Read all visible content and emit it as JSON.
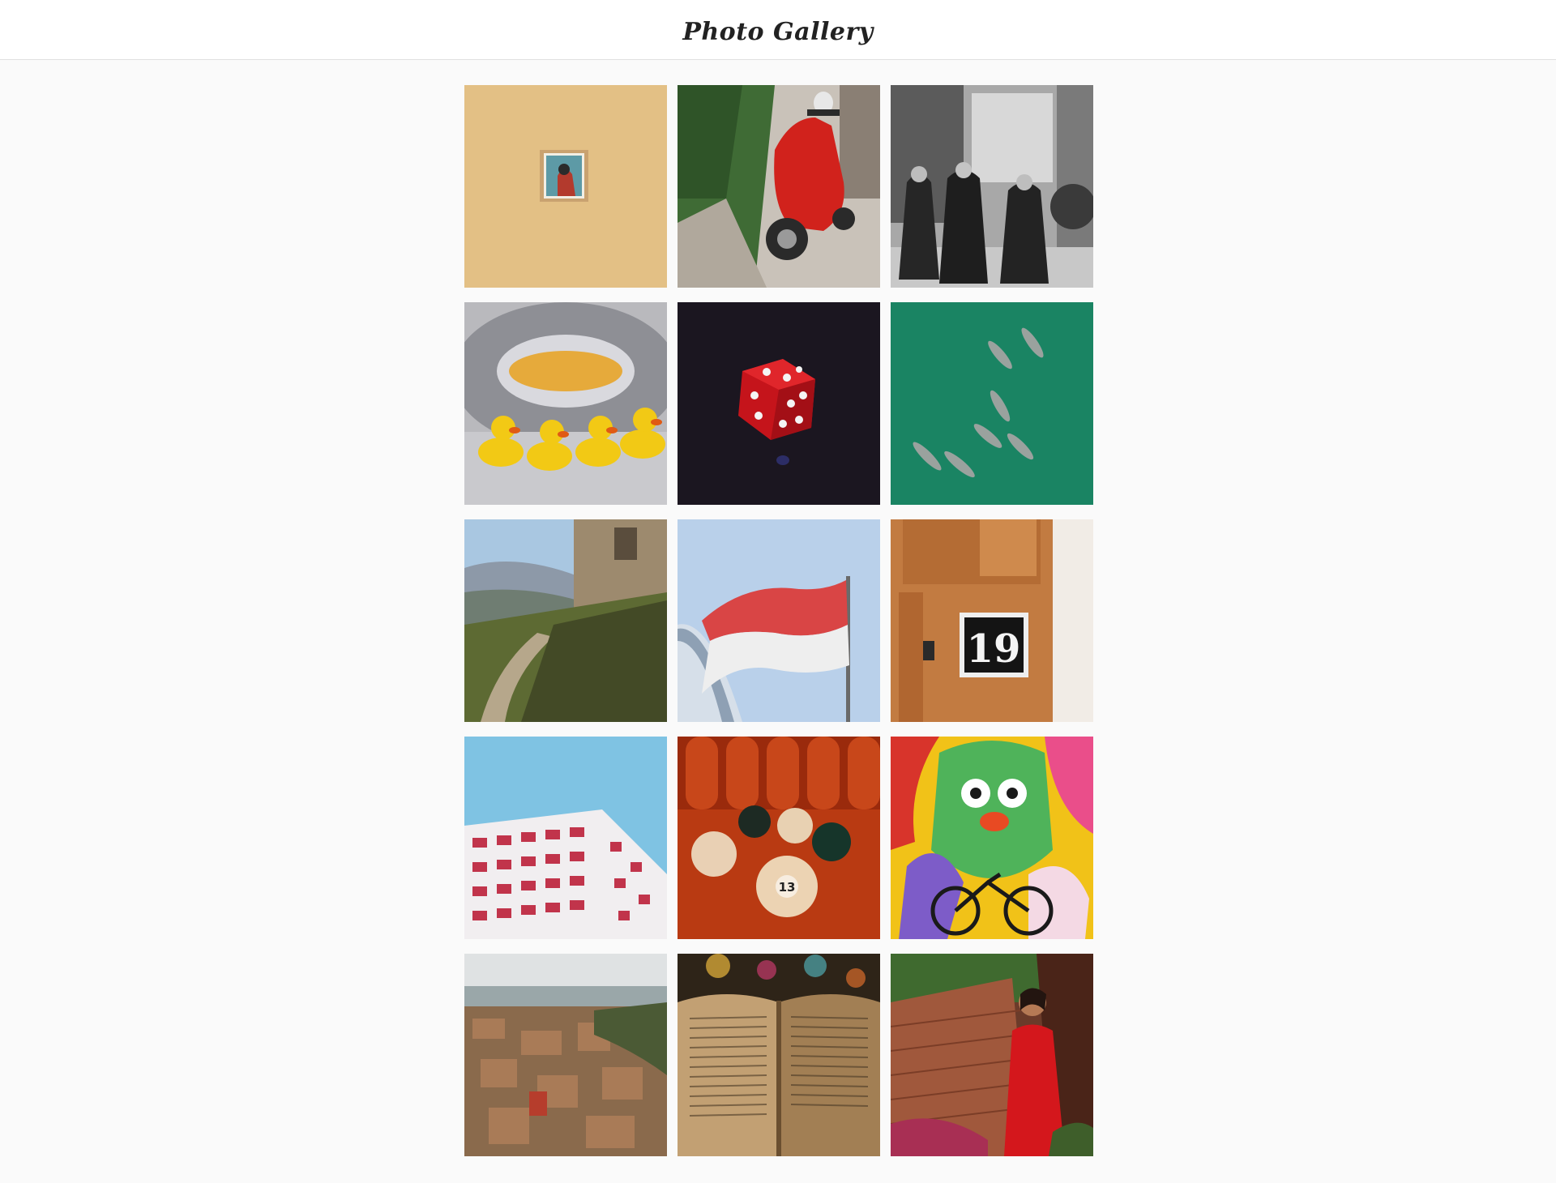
{
  "header": {
    "title": "Photo Gallery"
  },
  "gallery": {
    "photos": [
      {
        "subject": "framed portrait sticker on yellow wall"
      },
      {
        "subject": "red scooter parked on cobblestone street with ivy"
      },
      {
        "subject": "black and white photo of three women on a porch"
      },
      {
        "subject": "rubber ducks inside washing machine drum"
      },
      {
        "subject": "red translucent die on dark background"
      },
      {
        "subject": "aerial view of dolphins in green sea"
      },
      {
        "subject": "stone castle tower above hillside landscape"
      },
      {
        "subject": "red and white flag against blue sky"
      },
      {
        "subject": "wooden door with house number plate"
      },
      {
        "subject": "red and white apartment building against blue sky"
      },
      {
        "subject": "billiard balls on red table"
      },
      {
        "subject": "colorful graffiti mural with bicycle"
      },
      {
        "subject": "aerial view of old town rooftops"
      },
      {
        "subject": "open book with bokeh lights"
      },
      {
        "subject": "woman in red dress beside brick wall"
      }
    ],
    "door_number": "19",
    "billiard_ball_number": "13"
  }
}
